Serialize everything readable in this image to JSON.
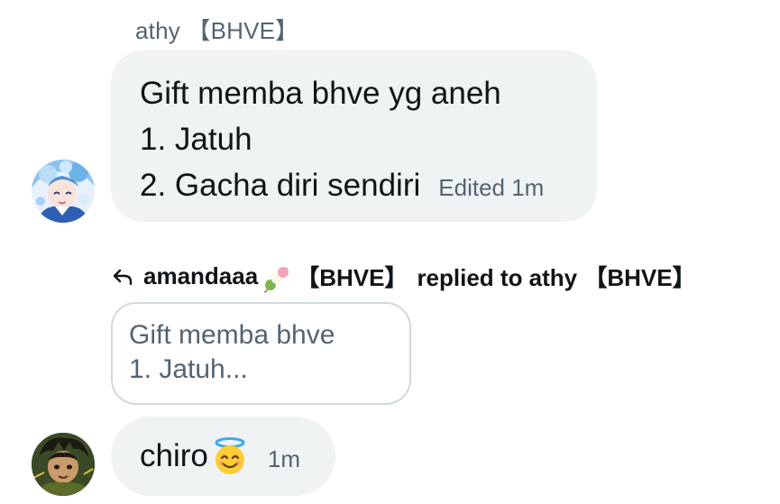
{
  "messages": [
    {
      "sender": "athy 【BHVE】",
      "lines": [
        "Gift memba bhve yg aneh",
        "1. Jatuh",
        "2. Gacha diri sendiri"
      ],
      "meta": "Edited 1m",
      "avatar_icon": "anime-avatar-icon"
    },
    {
      "reply_author": "amandaaa",
      "reply_author_suffix": "【BHVE】",
      "reply_action": "replied to athy 【BHVE】",
      "quote_lines": [
        "Gift memba bhve",
        "1. Jatuh..."
      ],
      "text": "chiro",
      "emoji": "smiling-face-with-halo-icon",
      "time": "1m",
      "avatar_icon": "anime-avatar-icon"
    }
  ],
  "colors": {
    "bubble_bg": "#eff3f4",
    "secondary_text": "#536471",
    "primary_text": "#0f1419",
    "quote_border": "#cfd9de"
  }
}
